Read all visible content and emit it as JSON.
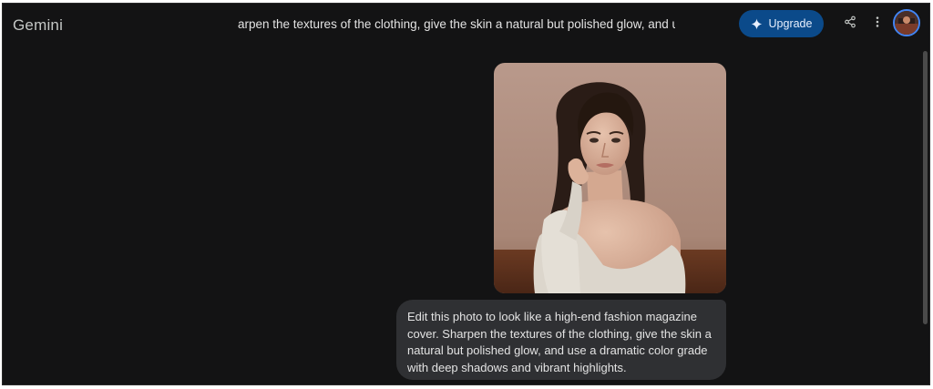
{
  "app": {
    "title": "Gemini"
  },
  "header": {
    "chat_title": "arpen the textures of the clothing, give the skin a natural but polished glow, and use a dramatic color grade with deep shadows and vibrant highlights.",
    "upgrade_label": "Upgrade",
    "icons": [
      "sparkle-icon",
      "share-icon",
      "more-vert-icon"
    ]
  },
  "conversation": {
    "user_image": {
      "icon": "photo-of-woman"
    },
    "user_message": "Edit this photo to look like a high-end fashion magazine cover. Sharpen the textures of the clothing, give the skin a natural but polished glow, and use a dramatic color grade with deep shadows and vibrant highlights."
  },
  "colors": {
    "background": "#131314",
    "upgrade_button": "#0b4a8a",
    "bubble": "#2f3033",
    "text": "#e3e3e3"
  }
}
